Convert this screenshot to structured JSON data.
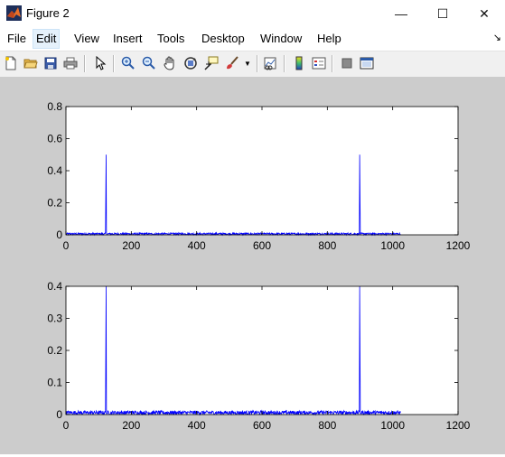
{
  "window": {
    "title": "Figure 2",
    "minimize": "—",
    "maximize": "☐",
    "close": "✕"
  },
  "menu": [
    "File",
    "Edit",
    "View",
    "Insert",
    "Tools",
    "Desktop",
    "Window",
    "Help"
  ],
  "toolbar": [
    "new-figure",
    "open-file",
    "save",
    "print",
    "edit-plot",
    "zoom-in",
    "zoom-out",
    "pan",
    "rotate-3d",
    "data-cursor",
    "brush",
    "link-plot",
    "insert-colorbar",
    "insert-legend",
    "hide-plot-tools",
    "show-plot-tools"
  ],
  "colors": {
    "line": "#0000ff",
    "figure_bg": "#cccccc",
    "axes_bg": "#ffffff"
  },
  "chart_data": [
    {
      "type": "line",
      "xlim": [
        0,
        1200
      ],
      "ylim": [
        0,
        0.8
      ],
      "x_ticks": [
        "0",
        "200",
        "400",
        "600",
        "800",
        "1000",
        "1200"
      ],
      "y_ticks": [
        "0",
        "0.2",
        "0.4",
        "0.6",
        "0.8"
      ],
      "n_points": 1024,
      "noise_level": 0.012,
      "spikes": [
        {
          "x": 123,
          "y": 0.5
        },
        {
          "x": 122,
          "y": 0.25
        },
        {
          "x": 899,
          "y": 0.5
        },
        {
          "x": 900,
          "y": 0.25
        }
      ]
    },
    {
      "type": "line",
      "xlim": [
        0,
        1200
      ],
      "ylim": [
        0,
        0.4
      ],
      "x_ticks": [
        "0",
        "200",
        "400",
        "600",
        "800",
        "1000",
        "1200"
      ],
      "y_ticks": [
        "0",
        "0.1",
        "0.2",
        "0.3",
        "0.4"
      ],
      "n_points": 1024,
      "noise_level": 0.012,
      "spikes": [
        {
          "x": 123,
          "y": 0.4
        },
        {
          "x": 122,
          "y": 0.2
        },
        {
          "x": 899,
          "y": 0.4
        },
        {
          "x": 900,
          "y": 0.2
        }
      ]
    }
  ]
}
